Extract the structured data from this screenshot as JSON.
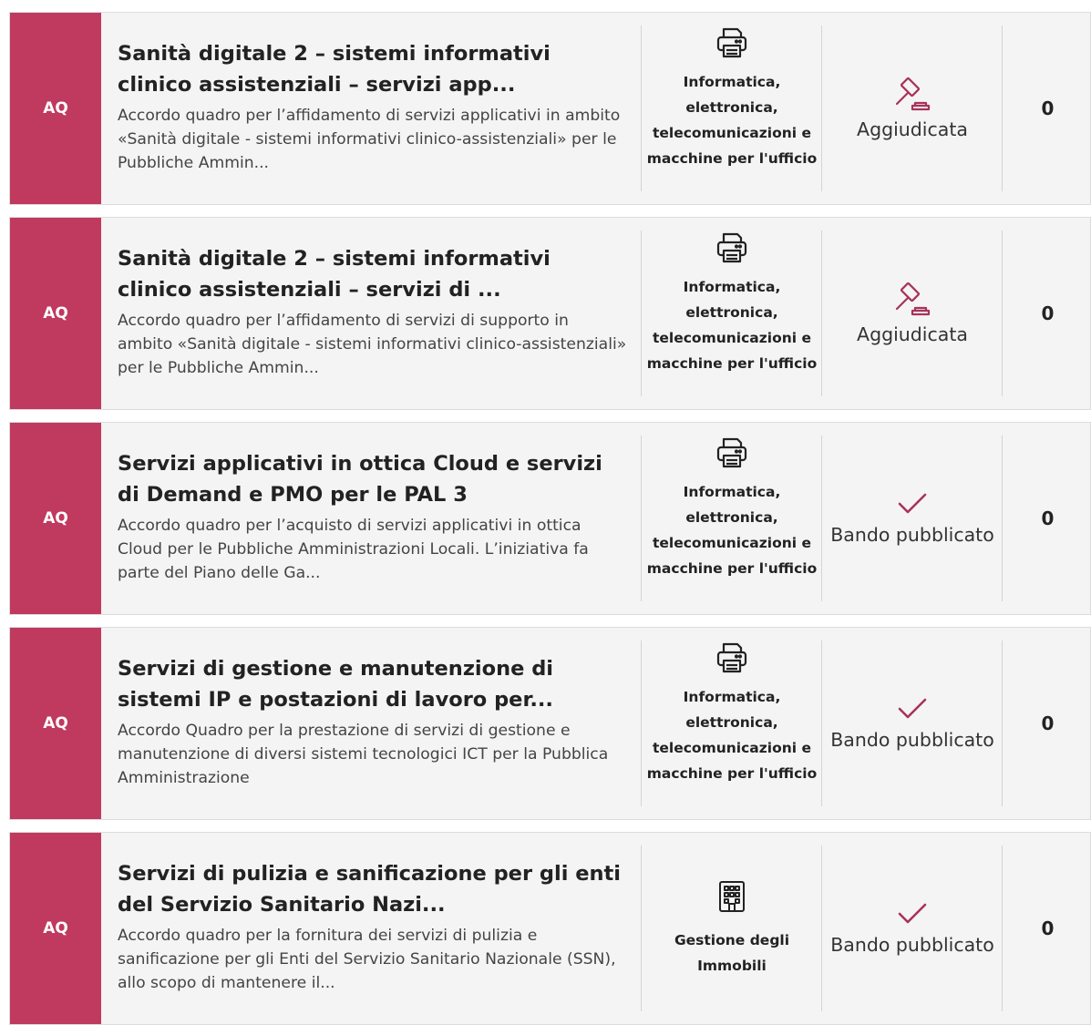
{
  "items": [
    {
      "badge": "AQ",
      "title": "Sanità digitale 2 – sistemi informativi clinico assistenziali – servizi app...",
      "description": "Accordo quadro per l’affidamento di servizi applicativi in ambito «Sanità digitale - sistemi informativi clinico-assistenziali» per le Pubbliche Ammin...",
      "category": "Informatica, elettronica, telecomunicazioni e macchine per l'ufficio",
      "category_icon": "printer-icon",
      "status": "Aggiudicata",
      "status_icon": "gavel-icon",
      "count": "0"
    },
    {
      "badge": "AQ",
      "title": "Sanità digitale 2 – sistemi informativi clinico assistenziali – servizi di ...",
      "description": "Accordo quadro per l’affidamento di servizi di supporto in ambito «Sanità digitale - sistemi informativi clinico-assistenziali» per le Pubbliche Ammin...",
      "category": "Informatica, elettronica, telecomunicazioni e macchine per l'ufficio",
      "category_icon": "printer-icon",
      "status": "Aggiudicata",
      "status_icon": "gavel-icon",
      "count": "0"
    },
    {
      "badge": "AQ",
      "title": "Servizi applicativi in ottica Cloud e servizi di Demand e PMO per le PAL 3",
      "description": "Accordo quadro per l’acquisto di servizi applicativi in ottica Cloud per le Pubbliche Amministrazioni Locali. L’iniziativa fa parte del Piano delle Ga...",
      "category": "Informatica, elettronica, telecomunicazioni e macchine per l'ufficio",
      "category_icon": "printer-icon",
      "status": "Bando pubblicato",
      "status_icon": "checkmark-icon",
      "count": "0"
    },
    {
      "badge": "AQ",
      "title": "Servizi di gestione e manutenzione di sistemi IP e postazioni di lavoro per...",
      "description": "Accordo Quadro per la prestazione di servizi di gestione e manutenzione di diversi sistemi tecnologici ICT per la Pubblica Amministrazione",
      "category": "Informatica, elettronica, telecomunicazioni e macchine per l'ufficio",
      "category_icon": "printer-icon",
      "status": "Bando pubblicato",
      "status_icon": "checkmark-icon",
      "count": "0"
    },
    {
      "badge": "AQ",
      "title": "Servizi di pulizia e sanificazione per gli enti del Servizio Sanitario Nazi...",
      "description": "Accordo quadro per la fornitura dei servizi di pulizia e sanificazione per gli Enti del Servizio Sanitario Nazionale (SSN), allo scopo di mantenere il...",
      "category": "Gestione degli Immobili",
      "category_icon": "building-icon",
      "status": "Bando pubblicato",
      "status_icon": "checkmark-icon",
      "count": "0"
    }
  ],
  "colors": {
    "badge_bg": "#c0395f",
    "status_icon": "#a8325a",
    "card_bg": "#f4f4f4"
  }
}
